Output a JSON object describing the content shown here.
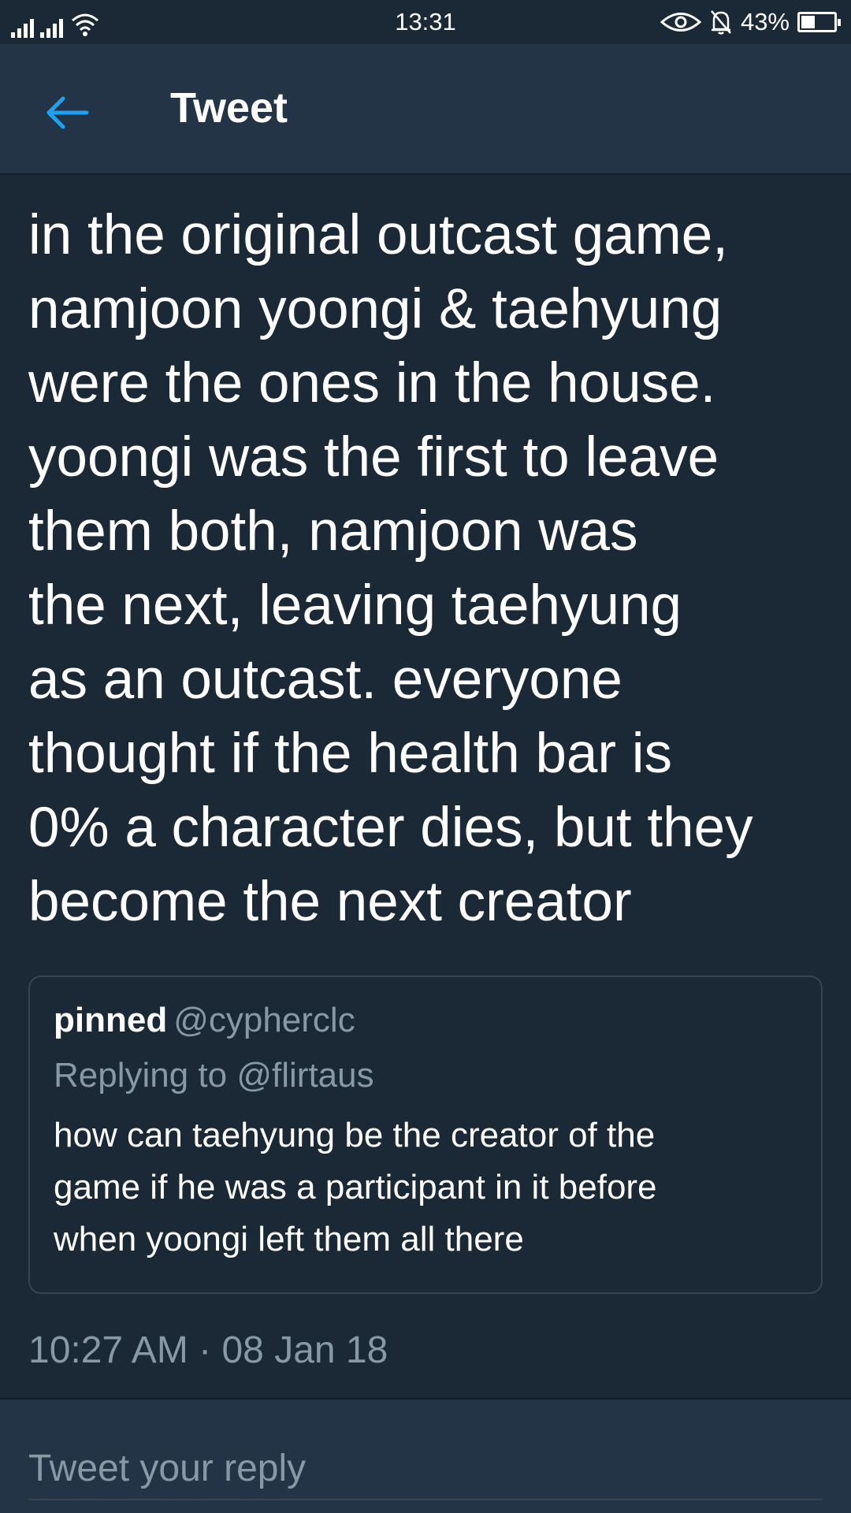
{
  "status_bar": {
    "time": "13:31",
    "battery_percent_label": "43%",
    "battery_level": 0.43,
    "icons": [
      "signal-icon",
      "signal-icon",
      "wifi-icon",
      "eye-icon",
      "bell-off-icon",
      "battery-icon"
    ]
  },
  "header": {
    "title": "Tweet",
    "back_icon": "back-arrow-icon",
    "accent": "#1da1f2"
  },
  "tweet": {
    "lines": [
      "in the original outcast game,",
      "namjoon yoongi & taehyung",
      "were the ones in the house.",
      "yoongi was the first to leave",
      "them both, namjoon was",
      "the next, leaving taehyung",
      "as an outcast. everyone",
      "thought if the health bar is",
      "0% a character dies, but they",
      "become the next creator"
    ],
    "quoted": {
      "name": "pinned",
      "handle": "@cypherclc",
      "replying_to": "Replying to @flirtaus",
      "lines": [
        "how can taehyung be the creator of the",
        "game if he was a participant in it before",
        "when yoongi left them all there"
      ]
    },
    "timestamp": "10:27 AM · 08 Jan 18"
  },
  "reply": {
    "placeholder": "Tweet your reply"
  },
  "colors": {
    "background": "#1b2836",
    "bar": "#243447",
    "secondary_text": "#8899a6",
    "border": "#38444d"
  }
}
